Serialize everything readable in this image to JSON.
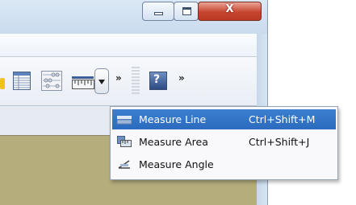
{
  "window": {
    "caption_buttons": {
      "minimize_icon": "minimize-icon",
      "maximize_icon": "maximize-icon",
      "close_glyph": "X"
    }
  },
  "toolbar": {
    "icons": [
      "table-icon",
      "calculator-icon",
      "ruler-icon",
      "chevron-down-icon",
      "help-icon"
    ],
    "overflow_chevron_1": "»",
    "overflow_chevron_2": "»",
    "help_glyph": "?"
  },
  "menu": {
    "items": [
      {
        "label": "Measure Line",
        "shortcut": "Ctrl+Shift+M",
        "icon": "measure-line-icon",
        "selected": true
      },
      {
        "label": "Measure Area",
        "shortcut": "Ctrl+Shift+J",
        "icon": "measure-area-icon",
        "selected": false
      },
      {
        "label": "Measure Angle",
        "shortcut": "",
        "icon": "measure-angle-icon",
        "selected": false
      }
    ]
  },
  "colors": {
    "selection": "#3575c8",
    "map_background": "#b5ad7c",
    "close_button": "#c7442f"
  }
}
